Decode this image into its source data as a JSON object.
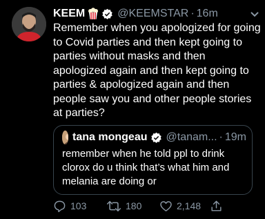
{
  "tweet": {
    "display_name": "KEEM",
    "name_emoji": "popcorn-icon",
    "verified": "verified-badge-icon",
    "handle": "@KEEMSTAR",
    "separator": "·",
    "time": "16m",
    "text": "Remember when you apologized for going to Covid parties and then kept going to parties without masks and then apologized again and then kept going to parties & apologized again and then people saw you and other people stories at parties?"
  },
  "quoted_tweet": {
    "display_name": "tana mongeau",
    "verified": "verified-badge-icon",
    "handle": "@tanam...",
    "separator": "·",
    "time": "19m",
    "text": "remember when he told ppl to drink clorox do u think that’s what him and melania are doing or"
  },
  "actions": {
    "replies": "103",
    "retweets": "180",
    "likes": "2,148"
  },
  "colors": {
    "background": "#000000",
    "text": "#ffffff",
    "secondary": "#8b98a5",
    "verified": "#ffffff",
    "border": "#38444d"
  }
}
